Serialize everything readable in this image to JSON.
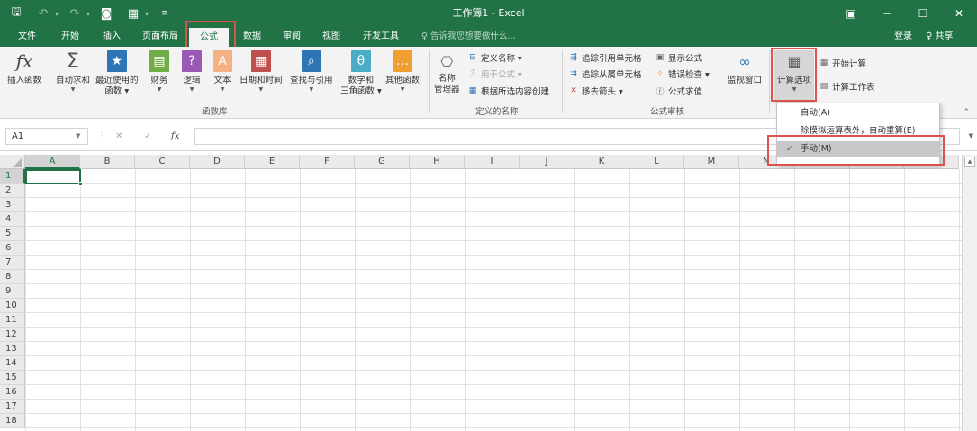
{
  "window": {
    "title": "工作簿1 - Excel",
    "controls": [
      "restore-ribbon-icon",
      "minimize-icon",
      "maximize-icon",
      "close-icon"
    ]
  },
  "qat": {
    "icons": [
      "save-icon",
      "undo-icon",
      "redo-icon",
      "camera-icon",
      "form-icon",
      "customize-icon"
    ]
  },
  "tabs": [
    {
      "label": "文件"
    },
    {
      "label": "开始"
    },
    {
      "label": "插入"
    },
    {
      "label": "页面布局"
    },
    {
      "label": "公式",
      "active": true
    },
    {
      "label": "数据"
    },
    {
      "label": "审阅"
    },
    {
      "label": "视图"
    },
    {
      "label": "开发工具"
    }
  ],
  "tellme": {
    "text": "♀ 告诉我您想要做什么..."
  },
  "account": {
    "login": "登录",
    "share": "♀ 共享"
  },
  "ribbon": {
    "function_library": {
      "label": "函数库",
      "buttons": [
        {
          "label": "插入函数"
        },
        {
          "label": "自动求和"
        },
        {
          "label": "最近使用的\n函数 ▾"
        },
        {
          "label": "财务"
        },
        {
          "label": "逻辑"
        },
        {
          "label": "文本"
        },
        {
          "label": "日期和时间"
        },
        {
          "label": "查找与引用"
        },
        {
          "label": "数学和\n三角函数 ▾"
        },
        {
          "label": "其他函数"
        }
      ]
    },
    "defined_names": {
      "label": "定义的名称",
      "manager": "名称\n管理器",
      "items": [
        "定义名称 ▾",
        "用于公式 ▾",
        "根据所选内容创建"
      ]
    },
    "formula_auditing": {
      "label": "公式审核",
      "items": [
        "追踪引用单元格",
        "追踪从属单元格",
        "移去箭头 ▾",
        "显示公式",
        "错误检查 ▾",
        "公式求值"
      ],
      "watch": "监视窗口"
    },
    "calculation": {
      "options": "计算选项",
      "items": [
        "开始计算",
        "计算工作表"
      ]
    }
  },
  "formula_bar": {
    "name_box": "A1",
    "fx": "fx",
    "cancel": "✕",
    "enter": "✓"
  },
  "grid": {
    "columns": [
      "A",
      "B",
      "C",
      "D",
      "E",
      "F",
      "G",
      "H",
      "I",
      "J",
      "K",
      "L",
      "M",
      "N",
      "O",
      "P",
      "Q"
    ],
    "rows": [
      "1",
      "2",
      "3",
      "4",
      "5",
      "6",
      "7",
      "8",
      "9",
      "10",
      "11",
      "12",
      "13",
      "14",
      "15",
      "16",
      "17",
      "18"
    ],
    "active_cell": "A1"
  },
  "dropdown": {
    "items": [
      {
        "label": "自动(A)"
      },
      {
        "label": "除模拟运算表外，自动重算(E)"
      },
      {
        "label": "手动(M)",
        "checked": true
      }
    ]
  }
}
